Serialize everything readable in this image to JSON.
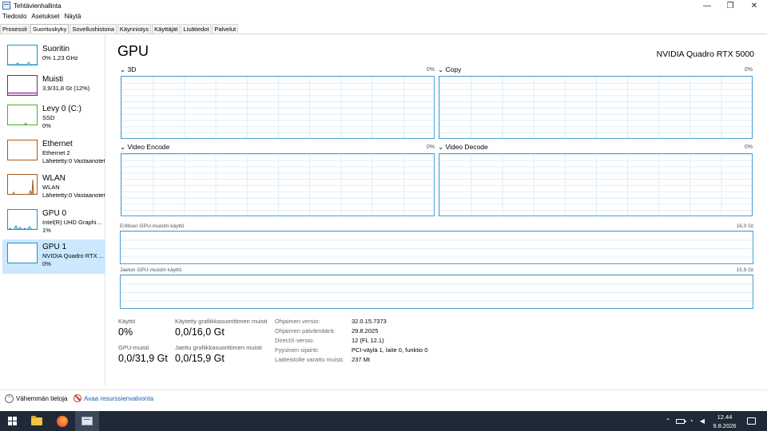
{
  "window": {
    "title": "Tehtävienhallinta",
    "minimize": "—",
    "maximize": "❐",
    "close": "✕"
  },
  "menu": [
    "Tiedosto",
    "Asetukset",
    "Näytä"
  ],
  "tabs": [
    "Prosessit",
    "Suorituskyky",
    "Sovellushistoria",
    "Käynnistys",
    "Käyttäjät",
    "Lisätiedot",
    "Palvelut"
  ],
  "active_tab": "Suorituskyky",
  "sidebar": {
    "items": [
      {
        "title": "Suoritin",
        "sub1": "0% 1,23 GHz",
        "sub2": "",
        "color": "#1e90c8"
      },
      {
        "title": "Muisti",
        "sub1": "3,9/31,8 Gt (12%)",
        "sub2": "",
        "color": "#8b1a8b"
      },
      {
        "title": "Levy 0 (C:)",
        "sub1": "SSD",
        "sub2": "0%",
        "color": "#4caf22"
      },
      {
        "title": "Ethernet",
        "sub1": "Ethernet 2",
        "sub2": "Lähetetty:0 Vastaanotetty:0",
        "color": "#a75a1a"
      },
      {
        "title": "WLAN",
        "sub1": "WLAN",
        "sub2": "Lähetetty:0 Vastaanotetty:0",
        "color": "#a75a1a"
      },
      {
        "title": "GPU 0",
        "sub1": "Intel(R) UHD Graphics...",
        "sub2": "1%",
        "color": "#1e90c8"
      },
      {
        "title": "GPU 1",
        "sub1": "NVIDIA Quadro RTX ...",
        "sub2": "0%",
        "color": "#1e90c8"
      }
    ],
    "active_index": 6
  },
  "main": {
    "heading": "GPU",
    "model": "NVIDIA Quadro RTX 5000",
    "engines": [
      {
        "label": "3D",
        "pct": "0%"
      },
      {
        "label": "Copy",
        "pct": "0%"
      },
      {
        "label": "Video Encode",
        "pct": "0%"
      },
      {
        "label": "Video Decode",
        "pct": "0%"
      }
    ],
    "dedicated_mem": {
      "label": "Erillisen GPU-muistin käyttö",
      "max": "16,0 Gt"
    },
    "shared_mem": {
      "label": "Jaetun GPU-muistin käyttö",
      "max": "15,9 Gt"
    }
  },
  "stats": {
    "utilization": {
      "label": "Käyttö",
      "value": "0%"
    },
    "dedicated": {
      "label": "Käytetty grafiikkasuorittimen muisti",
      "value": "0,0/16,0 Gt"
    },
    "gpu_memory": {
      "label": "GPU-muisti",
      "value": "0,0/31,9 Gt"
    },
    "shared": {
      "label": "Jaettu grafiikkasuorittimen muisti",
      "value": "0,0/15,9 Gt"
    }
  },
  "properties": [
    {
      "label": "Ohjaimen versio:",
      "value": "32.0.15.7373"
    },
    {
      "label": "Ohjaimen päivämäärä:",
      "value": "29.8.2025"
    },
    {
      "label": "DirectX-versio:",
      "value": "12 (FL 12.1)"
    },
    {
      "label": "Fyysinen sijainti:",
      "value": "PCI-väylä 1, laite 0, funktio 0"
    },
    {
      "label": "Laitteistolle varattu muisti:",
      "value": "237 Mt"
    }
  ],
  "footer": {
    "fewer_details": "Vähemmän tietoja",
    "open_resmon": "Avaa resurssienvalvonta"
  },
  "taskbar": {
    "time": "12.44",
    "date": "9.8.2026"
  }
}
